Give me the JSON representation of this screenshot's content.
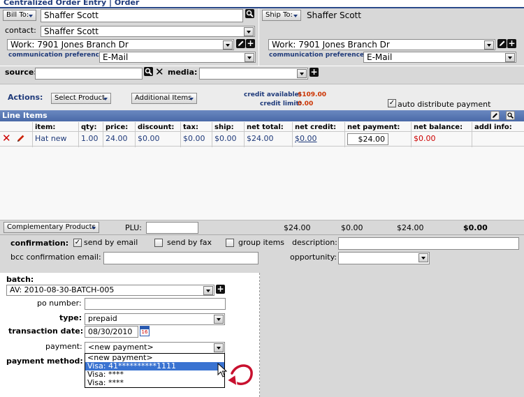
{
  "header": {
    "title": "Centralized Order Entry | Order"
  },
  "bill_to": {
    "button": "Bill To:",
    "name": "Shaffer Scott",
    "contact_label": "contact:",
    "contact_value": "Shaffer Scott",
    "address": "Work: 7901 Jones Branch Dr",
    "comm_label": "communication preference:",
    "comm_value": "E-Mail"
  },
  "ship_to": {
    "button": "Ship To:",
    "name": "Shaffer Scott",
    "address": "Work: 7901 Jones Branch Dr",
    "comm_label": "communication preference:",
    "comm_value": "E-Mail"
  },
  "source_row": {
    "source_label": "source:",
    "source_value": "",
    "media_label": "media:",
    "media_value": ""
  },
  "actions": {
    "label": "Actions:",
    "select_product": "Select Product",
    "additional_items": "Additional Items",
    "credit_available_label": "credit available:",
    "credit_available_value": "$109.00",
    "credit_limit_label": "credit limit:",
    "credit_limit_value": "0.00",
    "auto_distribute_label": "auto distribute payment",
    "auto_distribute_checked": true
  },
  "line_items": {
    "title": "Line Items",
    "columns": [
      "item:",
      "qty:",
      "price:",
      "discount:",
      "tax:",
      "ship:",
      "net total:",
      "net credit:",
      "net payment:",
      "net balance:",
      "addl info:"
    ],
    "rows": [
      {
        "item": "Hat new",
        "qty": "1.00",
        "price": "24.00",
        "discount": "$0.00",
        "tax": "$0.00",
        "ship": "$0.00",
        "net_total": "$24.00",
        "net_credit": "$0.00",
        "net_payment": "$24.00",
        "net_balance": "$0.00",
        "addl_info": ""
      }
    ]
  },
  "totals": {
    "complementary_products": "Complementary Products",
    "plu_label": "PLU:",
    "plu_value": "",
    "net_total": "$24.00",
    "net_credit": "$0.00",
    "net_payment": "$24.00",
    "net_balance": "$0.00"
  },
  "confirmation": {
    "label": "confirmation:",
    "send_by_email": "send by email",
    "send_by_email_checked": true,
    "send_by_fax": "send by fax",
    "send_by_fax_checked": false,
    "group_items": "group items",
    "group_items_checked": false,
    "description_label": "description:",
    "description_value": "",
    "bcc_label": "bcc confirmation email:",
    "bcc_value": "",
    "opportunity_label": "opportunity:",
    "opportunity_value": ""
  },
  "payment": {
    "batch_label": "batch:",
    "batch_value": "AV: 2010-08-30-BATCH-005",
    "po_label": "po number:",
    "po_value": "",
    "type_label": "type:",
    "type_value": "prepaid",
    "date_label": "transaction date:",
    "date_value": "08/30/2010",
    "payment_label": "payment:",
    "payment_value": "<new payment>",
    "method_label": "payment method:",
    "dropdown_options": [
      "<new payment>",
      "Visa: 41**********1111",
      "Visa: ****",
      "Visa: ****"
    ],
    "dropdown_selected_index": 1
  },
  "colors": {
    "accent": "#1f3a7a",
    "panel_gray": "#d8d8d8",
    "line_items_header": "#5070a8",
    "selection": "#3a73d1",
    "error_red": "#cc0000",
    "arrow_red": "#c8102e"
  }
}
